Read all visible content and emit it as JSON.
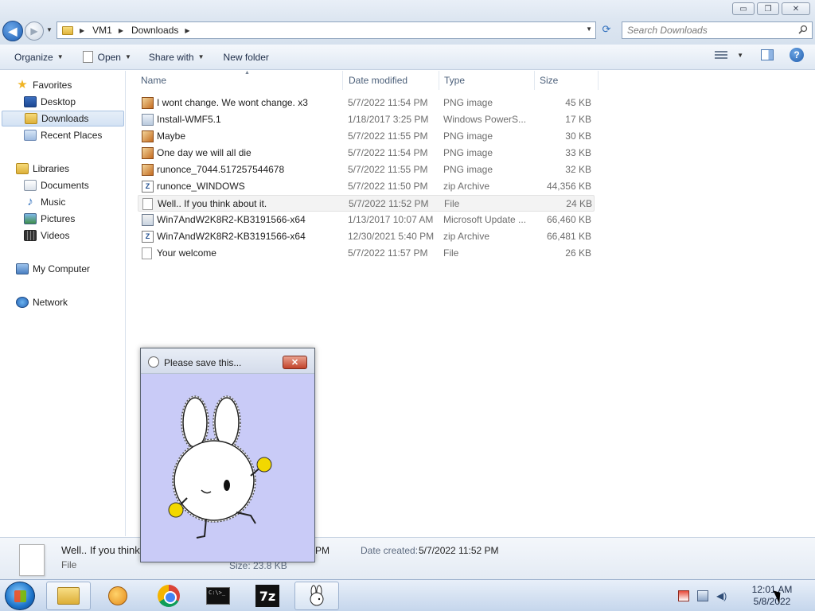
{
  "window": {
    "controls": {
      "minimize": "▭",
      "maximize": "❐",
      "close": "✕"
    }
  },
  "address": {
    "crumbs": [
      "VM1",
      "Downloads"
    ],
    "search_placeholder": "Search Downloads"
  },
  "commands": {
    "organize": "Organize",
    "open": "Open",
    "share": "Share with",
    "new_folder": "New folder"
  },
  "nav": {
    "favorites": "Favorites",
    "desktop": "Desktop",
    "downloads": "Downloads",
    "recent": "Recent Places",
    "libraries": "Libraries",
    "documents": "Documents",
    "music": "Music",
    "pictures": "Pictures",
    "videos": "Videos",
    "computer": "My Computer",
    "network": "Network"
  },
  "columns": {
    "name": "Name",
    "date": "Date modified",
    "type": "Type",
    "size": "Size"
  },
  "files": [
    {
      "name": "I wont change. We wont change. x3",
      "date": "5/7/2022 11:54 PM",
      "type": "PNG image",
      "size": "45 KB",
      "icon": "png-file-icon"
    },
    {
      "name": "Install-WMF5.1",
      "date": "1/18/2017 3:25 PM",
      "type": "Windows PowerS...",
      "size": "17 KB",
      "icon": "powershell-file-icon"
    },
    {
      "name": "Maybe",
      "date": "5/7/2022 11:55 PM",
      "type": "PNG image",
      "size": "30 KB",
      "icon": "png-file-icon"
    },
    {
      "name": "One day we will all die",
      "date": "5/7/2022 11:54 PM",
      "type": "PNG image",
      "size": "33 KB",
      "icon": "png-file-icon"
    },
    {
      "name": "runonce_7044.517257544678",
      "date": "5/7/2022 11:55 PM",
      "type": "PNG image",
      "size": "32 KB",
      "icon": "png-file-icon"
    },
    {
      "name": "runonce_WINDOWS",
      "date": "5/7/2022 11:50 PM",
      "type": "zip Archive",
      "size": "44,356 KB",
      "icon": "zip-file-icon"
    },
    {
      "name": "Well.. If you think about it.",
      "date": "5/7/2022 11:52 PM",
      "type": "File",
      "size": "24 KB",
      "icon": "generic-file-icon"
    },
    {
      "name": "Win7AndW2K8R2-KB3191566-x64",
      "date": "1/13/2017 10:07 AM",
      "type": "Microsoft Update ...",
      "size": "66,460 KB",
      "icon": "update-file-icon"
    },
    {
      "name": "Win7AndW2K8R2-KB3191566-x64",
      "date": "12/30/2021 5:40 PM",
      "type": "zip Archive",
      "size": "66,481 KB",
      "icon": "zip-file-icon"
    },
    {
      "name": "Your welcome",
      "date": "5/7/2022 11:57 PM",
      "type": "File",
      "size": "26 KB",
      "icon": "generic-file-icon"
    }
  ],
  "details": {
    "name": "Well.. If you think",
    "type": "File",
    "modified_tail": "PM",
    "created_label": "Date created:",
    "created_value": "5/7/2022 11:52 PM",
    "size": "Size: 23.8 KB"
  },
  "popup": {
    "title": "Please save this...",
    "close": "✕",
    "background": "#c9cbf7"
  },
  "taskbar": {
    "cmd_text": "C:\\>_",
    "sevenzip": "7z",
    "time": "12:01 AM",
    "date": "5/8/2022"
  }
}
